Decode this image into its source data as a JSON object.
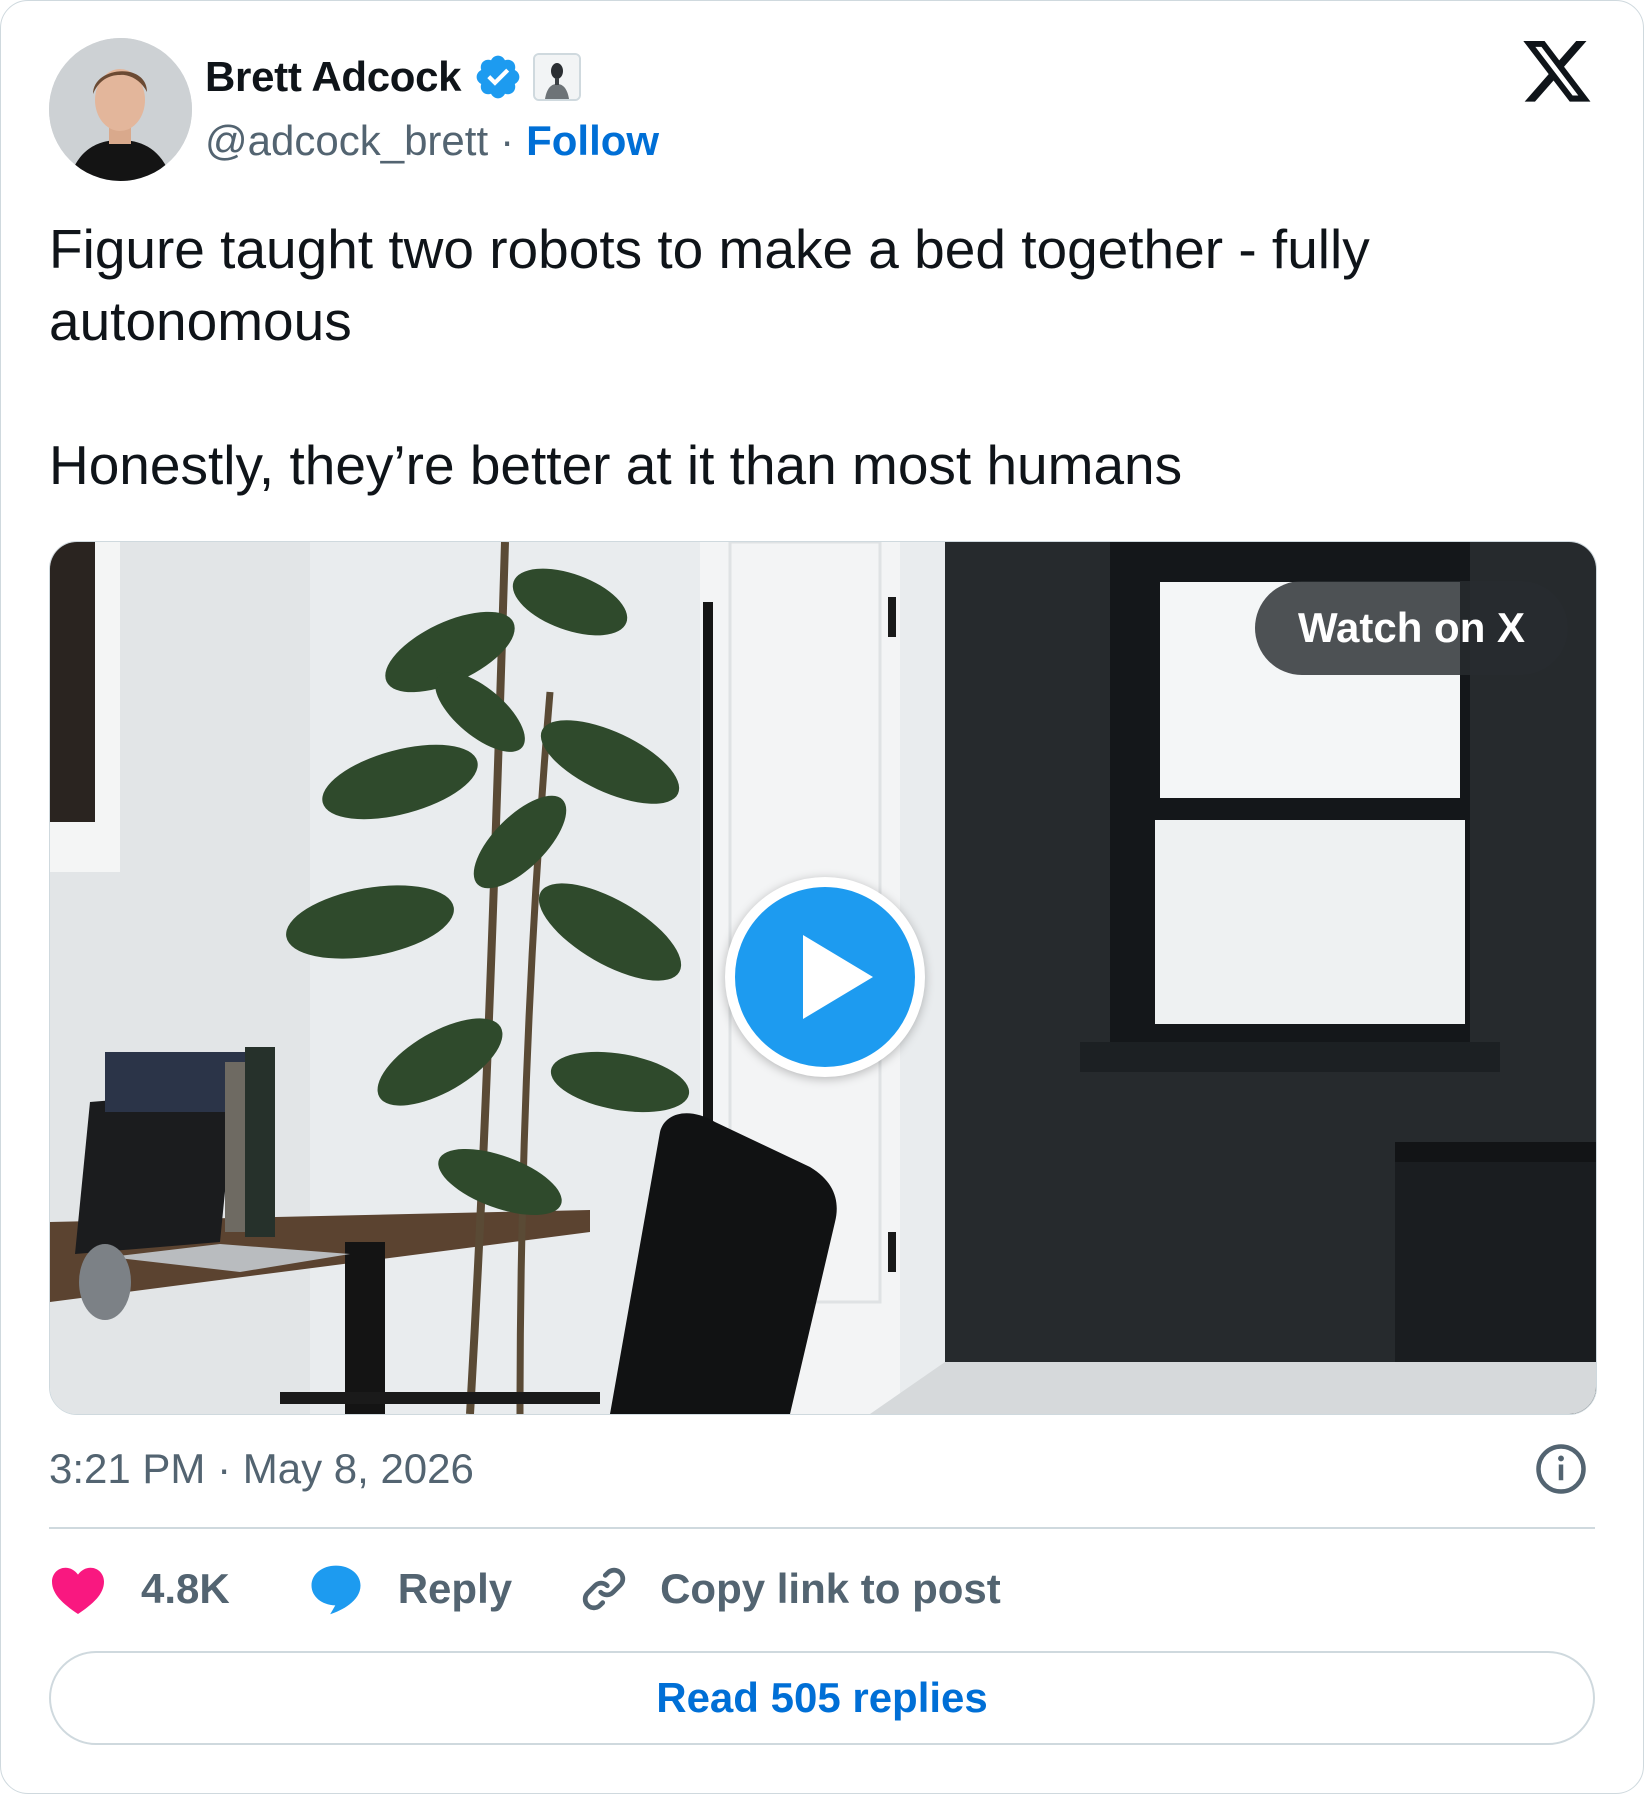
{
  "author": {
    "display_name": "Brett Adcock",
    "handle": "@adcock_brett",
    "separator": "·",
    "follow_label": "Follow"
  },
  "icons": {
    "brand": "x-logo-icon",
    "verified": "verified-badge-icon",
    "affiliate": "affiliate-badge-icon",
    "play": "play-icon",
    "info": "info-icon",
    "like": "heart-icon",
    "reply": "reply-bubble-icon",
    "copy": "link-icon"
  },
  "tweet": {
    "line1": "Figure taught two robots to make a bed together - fully autonomous",
    "line2": "Honestly, they’re better at it than most humans"
  },
  "media": {
    "watch_label": "Watch on X"
  },
  "meta": {
    "timestamp": "3:21 PM · May 8, 2026"
  },
  "actions": {
    "like_count": "4.8K",
    "reply_label": "Reply",
    "copy_label": "Copy link to post"
  },
  "footer": {
    "read_replies_label": "Read 505 replies"
  },
  "colors": {
    "verified_blue": "#1d9bf0",
    "link_blue": "#006fd6",
    "like_pink": "#f91880",
    "muted_text": "#536471",
    "border": "#cfd9de"
  }
}
